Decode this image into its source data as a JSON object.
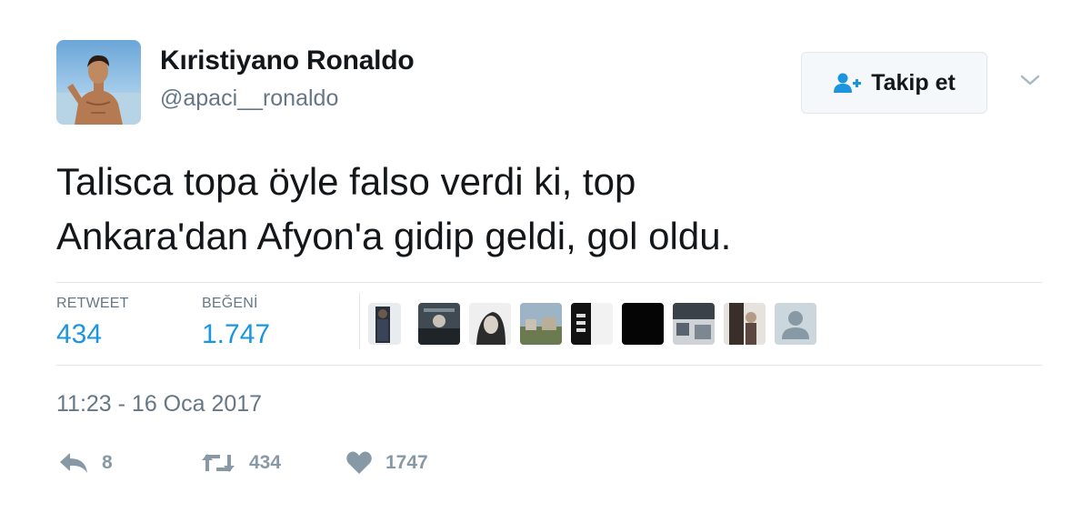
{
  "tweet": {
    "user": {
      "display_name": "Kıristiyano Ronaldo",
      "screen_name": "@apaci__ronaldo",
      "avatar_icon": "profile-photo"
    },
    "follow_button": {
      "label": "Takip et",
      "icon": "add-user-icon"
    },
    "text_lines": [
      "Talisca topa öyle falso verdi ki, top",
      "Ankara'dan Afyon'a gidip geldi, gol oldu."
    ],
    "stats": {
      "retweets": {
        "label": "RETWEET",
        "value": "434"
      },
      "likes": {
        "label": "BEĞENİ",
        "value": "1.747"
      }
    },
    "liker_avatars": [
      {
        "icon": "liker-photo"
      },
      {
        "icon": "liker-photo"
      },
      {
        "icon": "liker-photo"
      },
      {
        "icon": "liker-photo"
      },
      {
        "icon": "liker-photo"
      },
      {
        "icon": "liker-photo"
      },
      {
        "icon": "liker-photo"
      },
      {
        "icon": "liker-photo"
      },
      {
        "icon": "default-user-icon"
      }
    ],
    "timestamp": "11:23 - 16 Oca 2017",
    "actions": {
      "reply": {
        "icon": "reply-icon",
        "count": "8"
      },
      "retweet": {
        "icon": "retweet-icon",
        "count": "434"
      },
      "like": {
        "icon": "heart-icon",
        "count": "1747"
      }
    },
    "colors": {
      "accent": "#1b95e0",
      "secondary_text": "#657786",
      "action_gray": "#8899a6",
      "divider": "#e1e8ed"
    }
  }
}
